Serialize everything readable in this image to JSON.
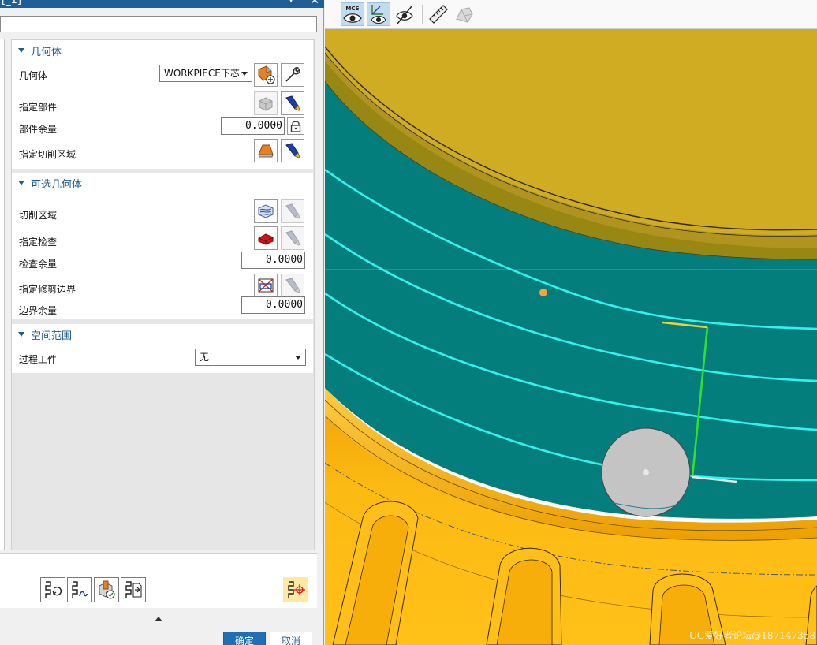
{
  "dialog": {
    "title": "[_1]",
    "geometry_group": {
      "header": "几何体",
      "geometry_label": "几何体",
      "geometry_value": "WORKPIECE下芯",
      "specify_part_label": "指定部件",
      "part_stock_label": "部件余量",
      "part_stock_value": "0.0000",
      "specify_cut_area_label": "指定切削区域"
    },
    "optional_group": {
      "header": "可选几何体",
      "cut_region_label": "切削区域",
      "specify_check_label": "指定检查",
      "check_stock_label": "检查余量",
      "check_stock_value": "0.0000",
      "specify_trim_label": "指定修剪边界",
      "boundary_stock_label": "边界余量",
      "boundary_stock_value": "0.0000"
    },
    "space_group": {
      "header": "空间范围",
      "in_process_label": "过程工件",
      "in_process_value": "无"
    },
    "ok_label": "确定",
    "cancel_label": "取消"
  },
  "toolbar": {
    "mcs_label": "MCS"
  },
  "viewport": {
    "watermark": "UG爱好者论坛@187147358"
  },
  "colors": {
    "panel_title": "#1e5b8e",
    "teal_floor": "#047e7c",
    "gold_top": "#cfac22",
    "orange_body": "#fcbb12",
    "toolpath": "#33f2ec",
    "step_line": "#2fe12f"
  }
}
